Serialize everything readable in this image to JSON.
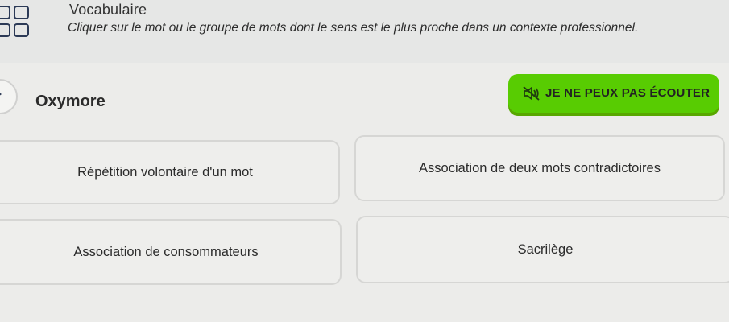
{
  "header": {
    "section_title": "Vocabulaire",
    "instruction": "Cliquer sur le mot ou le groupe de mots dont le sens est le plus proche dans un contexte professionnel.",
    "icon": "grid-icon"
  },
  "prompt": {
    "term": "Oxymore",
    "play_icon": "play-icon"
  },
  "cant_listen_button": {
    "label": "JE NE PEUX PAS ÉCOUTER",
    "icon": "mute-speaker-icon",
    "color": "#58cc02"
  },
  "options": [
    {
      "label": "Répétition volontaire d'un mot"
    },
    {
      "label": "Association de deux mots contradictoires"
    },
    {
      "label": "Association de consommateurs"
    },
    {
      "label": "Sacrilège"
    }
  ]
}
